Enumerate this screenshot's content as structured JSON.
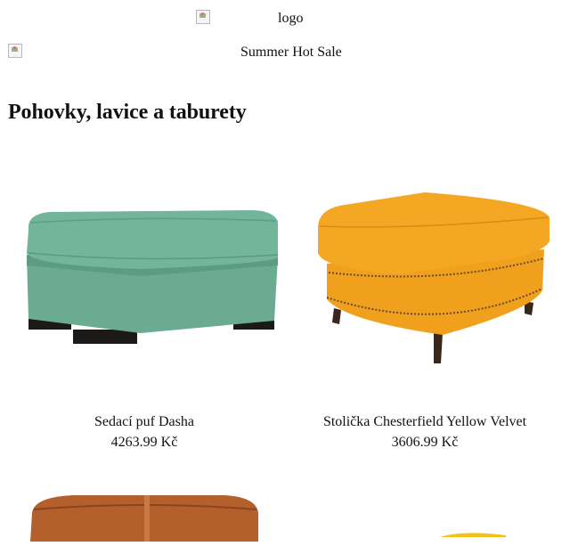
{
  "header": {
    "logo_alt": "logo",
    "banner_alt": "Summer Hot Sale"
  },
  "page": {
    "title": "Pohovky, lavice a taburety"
  },
  "products": [
    {
      "name": "Sedací puf Dasha",
      "price": "4263.99 Kč",
      "color": "#6cae94",
      "icon": "green-ottoman-image"
    },
    {
      "name": "Stolička Chesterfield Yellow Velvet",
      "price": "3606.99 Kč",
      "color": "#f0a11f",
      "icon": "orange-chesterfield-stool-image"
    },
    {
      "color": "#b5622e",
      "icon": "brown-leather-pouf-image"
    },
    {
      "color": "#f2c21a",
      "icon": "yellow-item-image"
    }
  ]
}
